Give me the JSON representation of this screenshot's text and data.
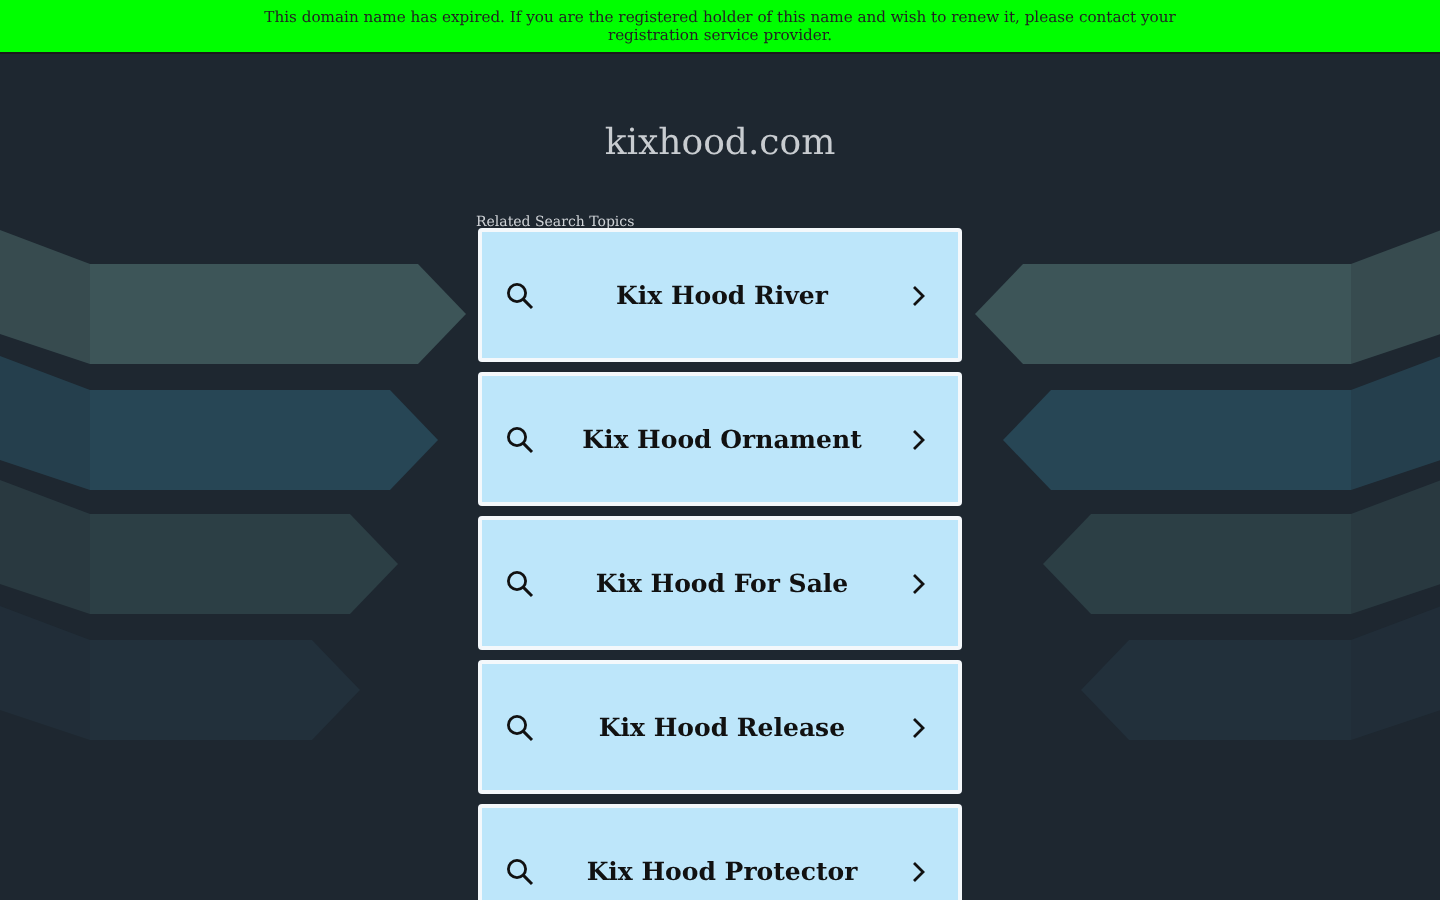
{
  "notice": "This domain name has expired. If you are the registered holder of this name and wish to renew it, please contact your registration service provider.",
  "domain": "kixhood.com",
  "section_title": "Related Search Topics",
  "topics": [
    {
      "label": "Kix Hood River"
    },
    {
      "label": "Kix Hood Ornament"
    },
    {
      "label": "Kix Hood For Sale"
    },
    {
      "label": "Kix Hood Release"
    },
    {
      "label": "Kix Hood Protector"
    }
  ]
}
